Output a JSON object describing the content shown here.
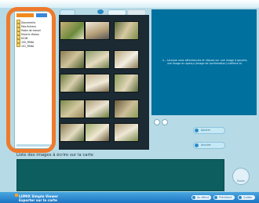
{
  "colors": {
    "highlight": "#ef7a2c",
    "preview_bg": "#00709f",
    "write_area_bg": "#0d5e5e",
    "bottom_bar": "#1c74c2"
  },
  "tree": {
    "header_label": "",
    "items": [
      {
        "label": "Documents",
        "icon": "folder-icon"
      },
      {
        "label": "Mes fichiers",
        "icon": "folder-icon"
      },
      {
        "label": "Poste de travail",
        "icon": "folder-icon"
      },
      {
        "label": "Favoris réseau",
        "icon": "folder-icon"
      },
      {
        "label": "DCIM",
        "icon": "folder-icon"
      },
      {
        "label": "100_PANA",
        "icon": "folder-icon"
      },
      {
        "label": "101_PANA",
        "icon": "folder-icon"
      }
    ]
  },
  "toolbar": {
    "left_button": "",
    "mid_button": "",
    "right_button": ""
  },
  "preview": {
    "message": "<-- Lorsque vous sélectionnez et cliquez sur une image à gauche, une image en aperçu (image de confirmation) s'affiche ici."
  },
  "actions": {
    "add_label": "Ajouter",
    "remove_label": "Annuler"
  },
  "list": {
    "title": "Liste des images à écrire sur la carte"
  },
  "write_button": {
    "label": "Ecrire"
  },
  "brand": {
    "line1": "LUMIX Simple Viewer",
    "line2": "Exporter sur la carte"
  },
  "bottom_buttons": [
    {
      "label": "Au début",
      "icon": "home-icon"
    },
    {
      "label": "Précédent",
      "icon": "back-icon"
    },
    {
      "label": "Quitter",
      "icon": "exit-icon"
    }
  ]
}
